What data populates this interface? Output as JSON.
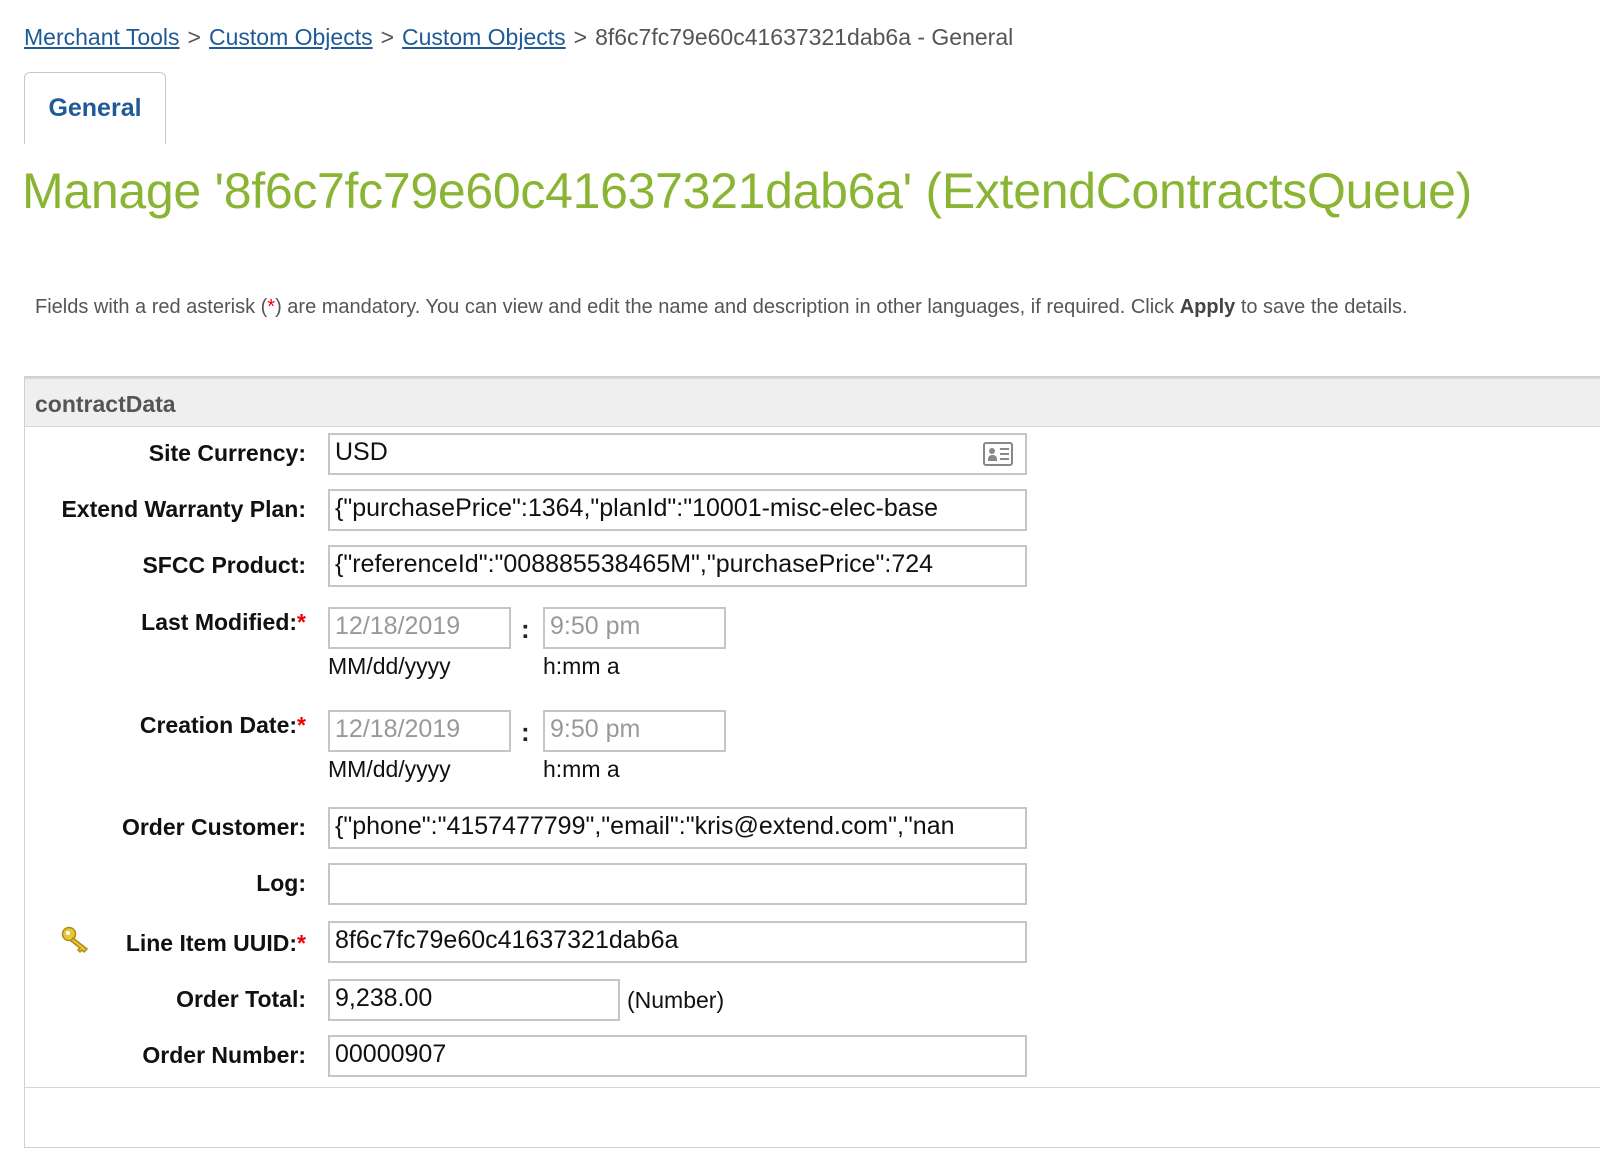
{
  "breadcrumb": {
    "items": [
      "Merchant Tools",
      "Custom Objects",
      "Custom Objects"
    ],
    "separator": ">",
    "current": "8f6c7fc79e60c41637321dab6a - General"
  },
  "tabs": [
    {
      "label": "General",
      "active": true
    }
  ],
  "page_title": "Manage '8f6c7fc79e60c41637321dab6a' (ExtendContractsQueue)",
  "instructions": {
    "part1": "Fields with a red asterisk (",
    "asterisk": "*",
    "part2": ") are mandatory. You can view and edit the name and description in other languages, if required. Click ",
    "apply": "Apply",
    "part3": " to save the details."
  },
  "section": {
    "title": "contractData",
    "fields": {
      "site_currency": {
        "label": "Site Currency:",
        "value": "USD"
      },
      "extend_warranty_plan": {
        "label": "Extend Warranty Plan:",
        "value": "{\"purchasePrice\":1364,\"planId\":\"10001-misc-elec-base"
      },
      "sfcc_product": {
        "label": "SFCC Product:",
        "value": "{\"referenceId\":\"008885538465M\",\"purchasePrice\":724"
      },
      "last_modified": {
        "label": "Last Modified:",
        "required": "*",
        "date": "12/18/2019",
        "time": "9:50 pm",
        "date_format": "MM/dd/yyyy",
        "time_format": "h:mm a",
        "separator": ":"
      },
      "creation_date": {
        "label": "Creation Date:",
        "required": "*",
        "date": "12/18/2019",
        "time": "9:50 pm",
        "date_format": "MM/dd/yyyy",
        "time_format": "h:mm a",
        "separator": ":"
      },
      "order_customer": {
        "label": "Order Customer:",
        "value": "{\"phone\":\"4157477799\",\"email\":\"kris@extend.com\",\"nan"
      },
      "log": {
        "label": "Log:",
        "value": ""
      },
      "line_item_uuid": {
        "label": "Line Item UUID:",
        "required": "*",
        "value": "8f6c7fc79e60c41637321dab6a"
      },
      "order_total": {
        "label": "Order Total:",
        "value": "9,238.00",
        "type_hint": "(Number)"
      },
      "order_number": {
        "label": "Order Number:",
        "value": "00000907"
      }
    }
  },
  "icons": {
    "site_currency_picker": "contact-card-icon",
    "uuid_key": "key-icon"
  },
  "colors": {
    "link": "#1f5a96",
    "title": "#8ab534",
    "required": "#e00000"
  }
}
